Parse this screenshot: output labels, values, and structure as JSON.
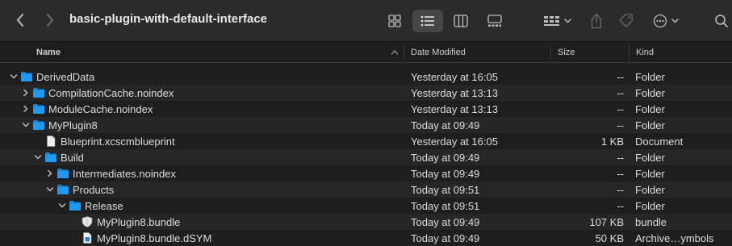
{
  "window": {
    "title": "basic-plugin-with-default-interface"
  },
  "toolbar": {
    "back_icon": "chevron-left-icon",
    "forward_icon": "chevron-right-icon",
    "view_icons": [
      "grid-view-icon",
      "list-view-icon",
      "column-view-icon",
      "gallery-view-icon"
    ],
    "active_view": "list",
    "group_icon": "group-by-icon",
    "share_icon": "share-icon",
    "tag_icon": "tag-icon",
    "more_icon": "ellipsis-circle-icon",
    "search_icon": "search-icon"
  },
  "columns": {
    "name": "Name",
    "date": "Date Modified",
    "size": "Size",
    "kind": "Kind"
  },
  "rows": [
    {
      "name": "DerivedData",
      "date": "Yesterday at 16:05",
      "size": "--",
      "kind": "Folder",
      "type": "folder",
      "expanded": true,
      "level": 0
    },
    {
      "name": "CompilationCache.noindex",
      "date": "Yesterday at 13:13",
      "size": "--",
      "kind": "Folder",
      "type": "folder",
      "expanded": false,
      "level": 1
    },
    {
      "name": "ModuleCache.noindex",
      "date": "Yesterday at 13:13",
      "size": "--",
      "kind": "Folder",
      "type": "folder",
      "expanded": false,
      "level": 1
    },
    {
      "name": "MyPlugin8",
      "date": "Today at 09:49",
      "size": "--",
      "kind": "Folder",
      "type": "folder",
      "expanded": true,
      "level": 1
    },
    {
      "name": "Blueprint.xcscmblueprint",
      "date": "Yesterday at 16:05",
      "size": "1 KB",
      "kind": "Document",
      "type": "document",
      "level": 2
    },
    {
      "name": "Build",
      "date": "Today at 09:49",
      "size": "--",
      "kind": "Folder",
      "type": "folder",
      "expanded": true,
      "level": 2
    },
    {
      "name": "Intermediates.noindex",
      "date": "Today at 09:49",
      "size": "--",
      "kind": "Folder",
      "type": "folder",
      "expanded": false,
      "level": 3
    },
    {
      "name": "Products",
      "date": "Today at 09:51",
      "size": "--",
      "kind": "Folder",
      "type": "folder",
      "expanded": true,
      "level": 3
    },
    {
      "name": "Release",
      "date": "Today at 09:51",
      "size": "--",
      "kind": "Folder",
      "type": "folder",
      "expanded": true,
      "level": 4
    },
    {
      "name": "MyPlugin8.bundle",
      "date": "Today at 09:49",
      "size": "107 KB",
      "kind": "bundle",
      "type": "bundle",
      "level": 5
    },
    {
      "name": "MyPlugin8.bundle.dSYM",
      "date": "Today at 09:49",
      "size": "50 KB",
      "kind": "Archive…ymbols",
      "type": "dsym",
      "level": 5
    }
  ],
  "colors": {
    "folder": "#1e9bf0",
    "folder_tab": "#1584d6",
    "background": "#1e1e1e",
    "alt_row": "#262626",
    "toolbar": "#2b2b2b"
  }
}
